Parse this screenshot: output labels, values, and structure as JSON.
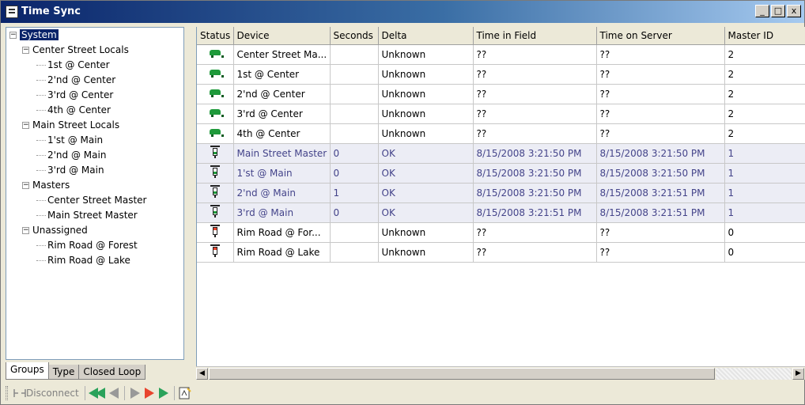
{
  "window": {
    "title": "Time Sync",
    "buttons": [
      "_",
      "□",
      "x"
    ]
  },
  "tree": {
    "root": "System",
    "groups": [
      {
        "label": "Center Street Locals",
        "items": [
          "1st @ Center",
          "2'nd @ Center",
          "3'rd @ Center",
          "4th @ Center"
        ]
      },
      {
        "label": "Main Street Locals",
        "items": [
          "1'st @ Main",
          "2'nd @ Main",
          "3'rd @ Main"
        ]
      },
      {
        "label": "Masters",
        "items": [
          "Center Street Master",
          "Main Street Master"
        ]
      },
      {
        "label": "Unassigned",
        "items": [
          "Rim Road @ Forest",
          "Rim Road @ Lake"
        ]
      }
    ],
    "expander_symbol": "−"
  },
  "tabs": [
    "Groups",
    "Type",
    "Closed Loop"
  ],
  "table": {
    "columns": [
      "Status",
      "Device",
      "Seconds",
      "Delta",
      "Time in Field",
      "Time on Server",
      "Master ID"
    ],
    "rows": [
      {
        "status": "car-green-icon",
        "device": "Center Street Ma...",
        "seconds": "",
        "delta": "Unknown",
        "field": "??",
        "server": "??",
        "master": "2",
        "kind": "local"
      },
      {
        "status": "car-green-icon",
        "device": "1st @ Center",
        "seconds": "",
        "delta": "Unknown",
        "field": "??",
        "server": "??",
        "master": "2",
        "kind": "local"
      },
      {
        "status": "car-green-icon",
        "device": "2'nd @ Center",
        "seconds": "",
        "delta": "Unknown",
        "field": "??",
        "server": "??",
        "master": "2",
        "kind": "local"
      },
      {
        "status": "car-green-icon",
        "device": "3'rd @ Center",
        "seconds": "",
        "delta": "Unknown",
        "field": "??",
        "server": "??",
        "master": "2",
        "kind": "local"
      },
      {
        "status": "car-green-icon",
        "device": "4th @ Center",
        "seconds": "",
        "delta": "Unknown",
        "field": "??",
        "server": "??",
        "master": "2",
        "kind": "local"
      },
      {
        "status": "traffic-light-green-icon",
        "device": "Main Street Master",
        "seconds": "0",
        "delta": "OK",
        "field": "8/15/2008 3:21:50 PM",
        "server": "8/15/2008 3:21:50 PM",
        "master": "1",
        "kind": "master"
      },
      {
        "status": "traffic-light-green-icon",
        "device": "1'st @ Main",
        "seconds": "0",
        "delta": "OK",
        "field": "8/15/2008 3:21:50 PM",
        "server": "8/15/2008 3:21:50 PM",
        "master": "1",
        "kind": "master"
      },
      {
        "status": "traffic-light-green-icon",
        "device": "2'nd @ Main",
        "seconds": "1",
        "delta": "OK",
        "field": "8/15/2008 3:21:50 PM",
        "server": "8/15/2008 3:21:51 PM",
        "master": "1",
        "kind": "master"
      },
      {
        "status": "traffic-light-green-icon",
        "device": "3'rd @ Main",
        "seconds": "0",
        "delta": "OK",
        "field": "8/15/2008 3:21:51 PM",
        "server": "8/15/2008 3:21:51 PM",
        "master": "1",
        "kind": "master"
      },
      {
        "status": "traffic-light-red-icon",
        "device": "Rim Road @ For...",
        "seconds": "",
        "delta": "Unknown",
        "field": "??",
        "server": "??",
        "master": "0",
        "kind": "local"
      },
      {
        "status": "traffic-light-red-icon",
        "device": "Rim Road @ Lake",
        "seconds": "",
        "delta": "Unknown",
        "field": "??",
        "server": "??",
        "master": "0",
        "kind": "local"
      }
    ]
  },
  "toolbar": {
    "disconnect_label": "Disconnect"
  },
  "colors": {
    "title_start": "#0a246a",
    "title_end": "#a6caf0",
    "selection": "#0a246a",
    "master_text": "#44448a",
    "green": "#1f9a3b",
    "red": "#e8442e"
  }
}
